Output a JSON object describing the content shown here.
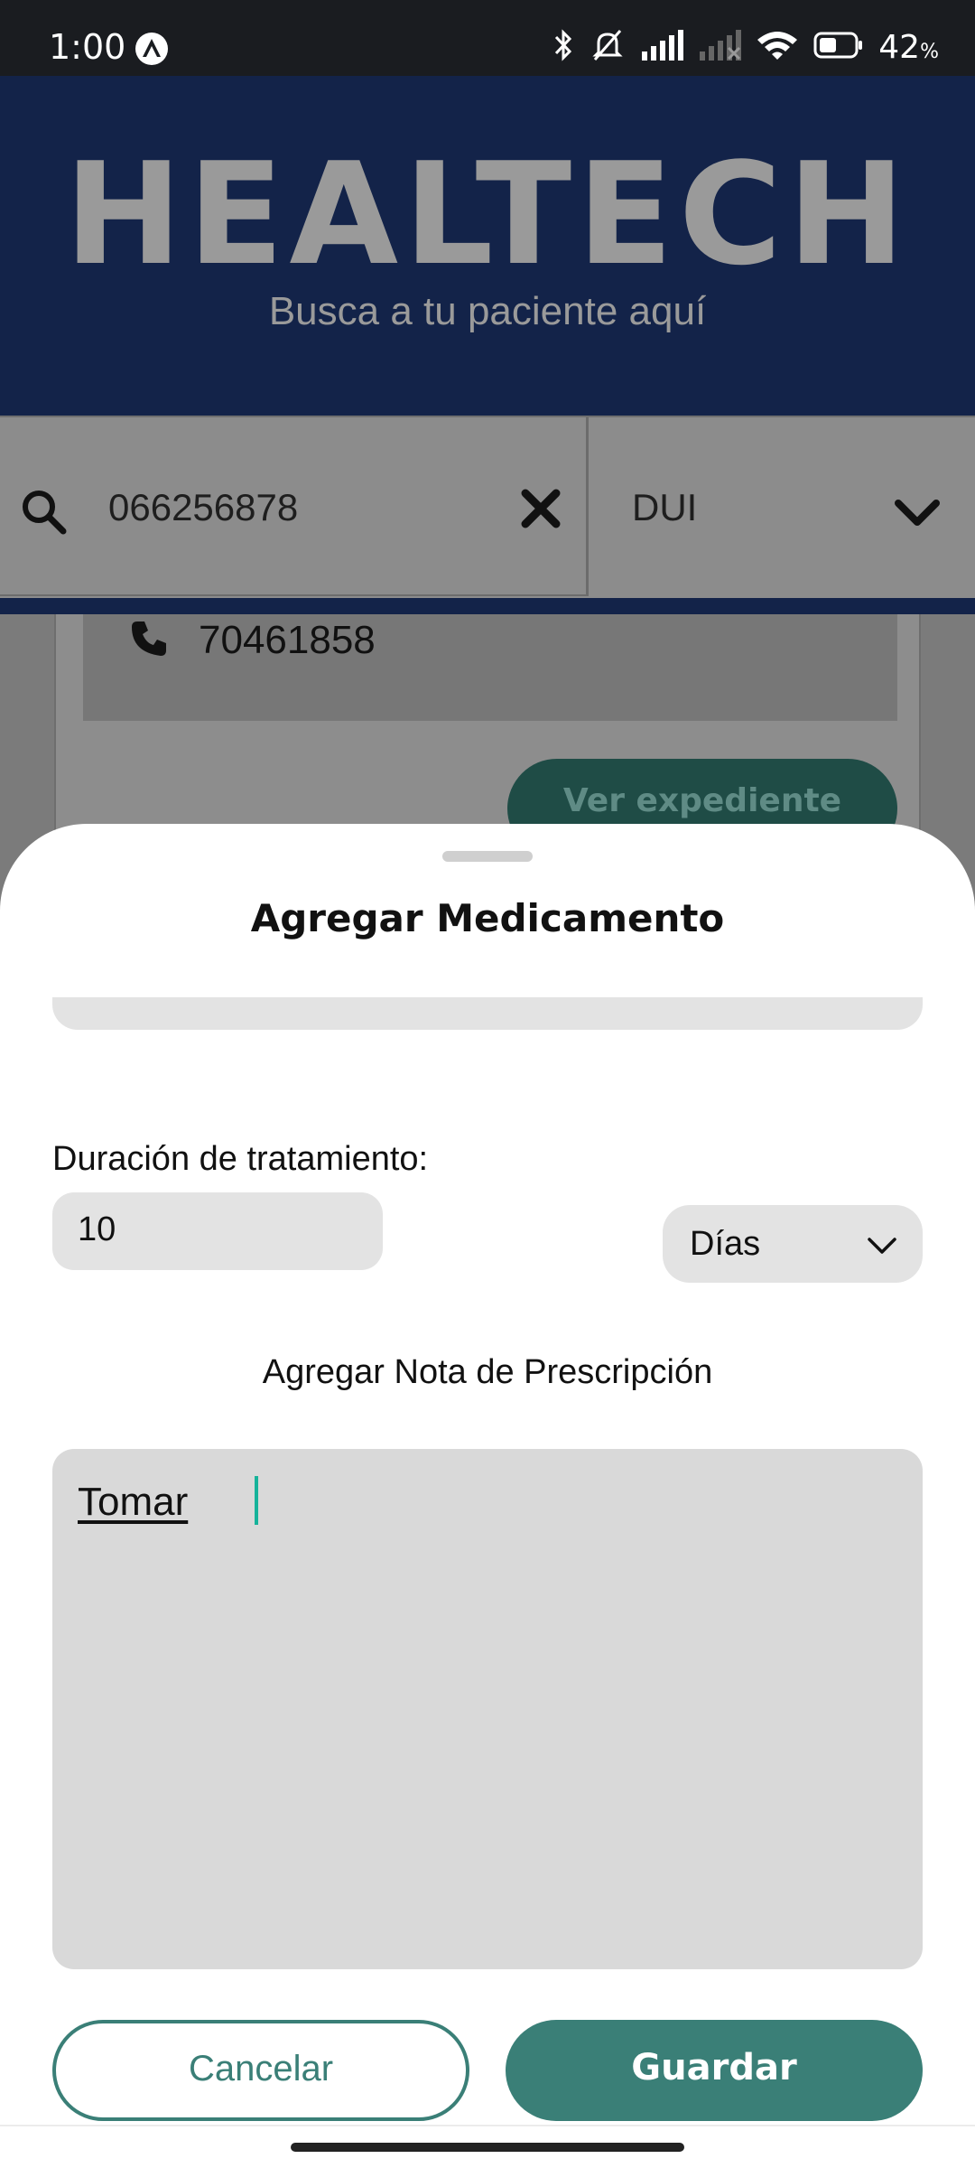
{
  "status_bar": {
    "time": "1:00",
    "battery_percent": "42",
    "battery_unit": "%",
    "icons": [
      "app-notification-icon",
      "bluetooth-icon",
      "silent-icon",
      "signal-icon",
      "signal-no-service-icon",
      "wifi-icon",
      "battery-icon"
    ]
  },
  "background": {
    "brand": "HEALTECH",
    "tagline": "Busca a tu paciente aquí",
    "search": {
      "value": "066256878"
    },
    "document_type": "DUI",
    "patient_phone": "70461858",
    "view_record_label": "Ver expediente",
    "header_color": "#132349"
  },
  "sheet": {
    "title": "Agregar Medicamento",
    "duration": {
      "label": "Duración de tratamiento:",
      "value": "10",
      "unit": "Días"
    },
    "note": {
      "label": "Agregar Nota de Prescripción",
      "value": "Tomar"
    },
    "cancel_label": "Cancelar",
    "save_label": "Guardar",
    "accent_color": "#3a7f77"
  }
}
